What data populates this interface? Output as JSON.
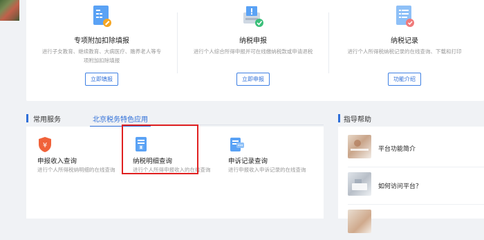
{
  "top_services": [
    {
      "title": "专项附加扣除填报",
      "desc": "进行子女教育、继续教育、大病医疗、赡养老人等专项附加扣除填报",
      "button": "立即填报",
      "icon": "document-edit-icon"
    },
    {
      "title": "纳税申报",
      "desc": "进行个人综合所得申报并可在线缴纳税款或申请退税",
      "button": "立即申报",
      "icon": "tax-declare-icon"
    },
    {
      "title": "纳税记录",
      "desc": "进行个人所得税纳税记录的在线查询、下载和打印",
      "button": "功能介绍",
      "icon": "tax-record-icon"
    }
  ],
  "tabs": {
    "items": [
      "常用服务",
      "北京税务特色应用"
    ],
    "active_index": 1
  },
  "common_services": [
    {
      "title": "申报收入查询",
      "desc": "进行个人所得税纳明细的在线查询",
      "icon": "shield-yen-icon"
    },
    {
      "title": "纳税明细查询",
      "desc": "进行个人所得申报收入的在线查询",
      "icon": "tax-detail-icon"
    },
    {
      "title": "申诉记录查询",
      "desc": "进行申报收入申诉记录的在线查询",
      "icon": "appeal-record-icon"
    }
  ],
  "guide": {
    "title": "指导帮助",
    "items": [
      {
        "label": "平台功能简介"
      },
      {
        "label": "如何访问平台？"
      },
      {
        "label": ""
      }
    ]
  },
  "colors": {
    "accent": "#2f6fd8",
    "highlight": "#e02020",
    "shield": "#f0623a"
  }
}
